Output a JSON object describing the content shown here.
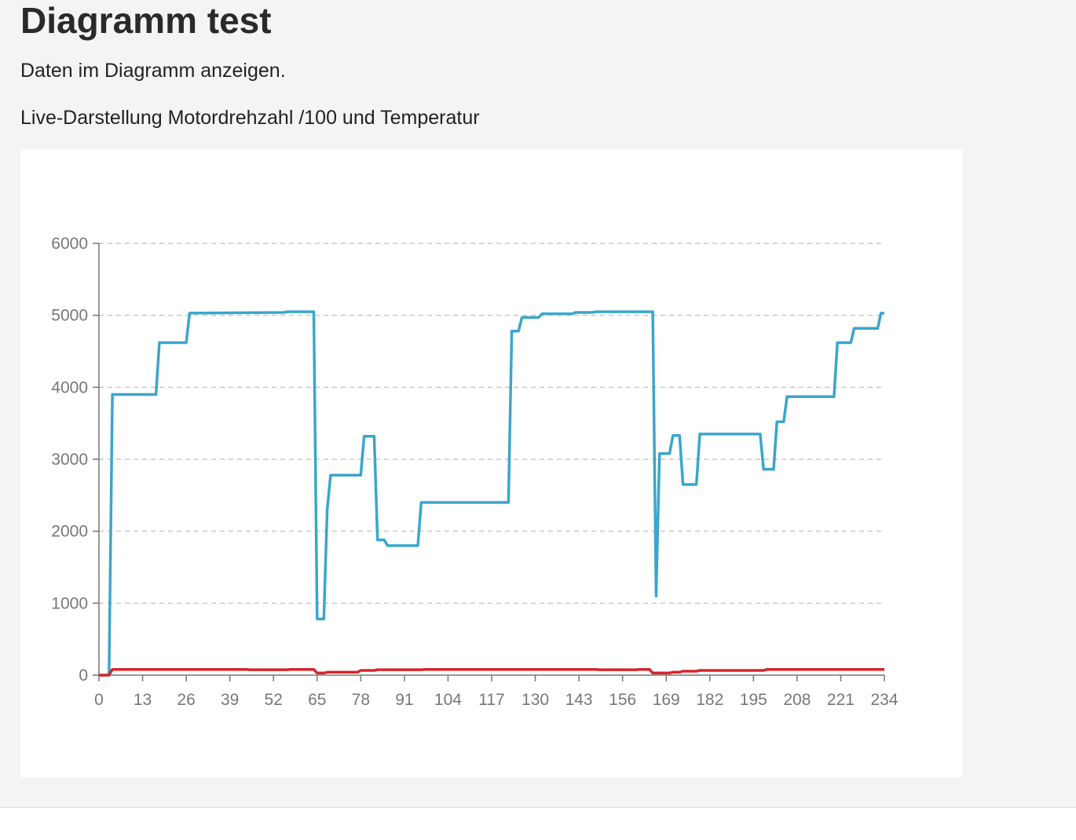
{
  "page": {
    "title": "Diagramm test",
    "description": "Daten im Diagramm anzeigen.",
    "chart_heading": "Live-Darstellung Motordrehzahl /100 und Temperatur"
  },
  "colors": {
    "background": "#f4f4f4",
    "card": "#ffffff",
    "series_rpm": "#3aa6cc",
    "series_temp": "#d6262c",
    "grid": "#c8c8c8",
    "axis": "#777777"
  },
  "chart_data": {
    "type": "line",
    "title": "",
    "xlabel": "",
    "ylabel": "",
    "xlim": [
      0,
      234
    ],
    "ylim": [
      0,
      6000
    ],
    "x_ticks": [
      0,
      13,
      26,
      39,
      52,
      65,
      78,
      91,
      104,
      117,
      130,
      143,
      156,
      169,
      182,
      195,
      208,
      221,
      234
    ],
    "y_ticks": [
      0,
      1000,
      2000,
      3000,
      4000,
      5000,
      6000
    ],
    "grid": "horizontal dashed",
    "legend": "none",
    "series": [
      {
        "color": "#3aa6cc",
        "points": [
          [
            0,
            0
          ],
          [
            3,
            0
          ],
          [
            4,
            3900
          ],
          [
            17,
            3900
          ],
          [
            18,
            4620
          ],
          [
            26,
            4620
          ],
          [
            27,
            5030
          ],
          [
            55,
            5040
          ],
          [
            56,
            5050
          ],
          [
            64,
            5050
          ],
          [
            65,
            780
          ],
          [
            67,
            780
          ],
          [
            68,
            2300
          ],
          [
            69,
            2780
          ],
          [
            78,
            2780
          ],
          [
            79,
            3320
          ],
          [
            82,
            3320
          ],
          [
            83,
            1880
          ],
          [
            85,
            1880
          ],
          [
            86,
            1800
          ],
          [
            95,
            1800
          ],
          [
            96,
            2400
          ],
          [
            122,
            2400
          ],
          [
            123,
            4780
          ],
          [
            125,
            4780
          ],
          [
            126,
            4970
          ],
          [
            131,
            4970
          ],
          [
            132,
            5020
          ],
          [
            141,
            5020
          ],
          [
            142,
            5040
          ],
          [
            147,
            5040
          ],
          [
            148,
            5050
          ],
          [
            165,
            5050
          ],
          [
            166,
            1100
          ],
          [
            167,
            3080
          ],
          [
            170,
            3080
          ],
          [
            171,
            3330
          ],
          [
            173,
            3330
          ],
          [
            174,
            2650
          ],
          [
            178,
            2650
          ],
          [
            179,
            3350
          ],
          [
            197,
            3350
          ],
          [
            198,
            2860
          ],
          [
            201,
            2860
          ],
          [
            202,
            3520
          ],
          [
            204,
            3520
          ],
          [
            205,
            3870
          ],
          [
            219,
            3870
          ],
          [
            220,
            4620
          ],
          [
            224,
            4620
          ],
          [
            225,
            4820
          ],
          [
            232,
            4820
          ],
          [
            233,
            5030
          ],
          [
            234,
            5030
          ]
        ]
      },
      {
        "color": "#d6262c",
        "points": [
          [
            0,
            0
          ],
          [
            3,
            0
          ],
          [
            4,
            80
          ],
          [
            44,
            80
          ],
          [
            45,
            75
          ],
          [
            56,
            75
          ],
          [
            57,
            80
          ],
          [
            64,
            80
          ],
          [
            65,
            30
          ],
          [
            67,
            30
          ],
          [
            68,
            40
          ],
          [
            77,
            40
          ],
          [
            78,
            65
          ],
          [
            82,
            65
          ],
          [
            83,
            75
          ],
          [
            96,
            75
          ],
          [
            97,
            80
          ],
          [
            148,
            80
          ],
          [
            149,
            75
          ],
          [
            160,
            75
          ],
          [
            161,
            80
          ],
          [
            164,
            80
          ],
          [
            165,
            30
          ],
          [
            170,
            30
          ],
          [
            171,
            40
          ],
          [
            173,
            40
          ],
          [
            174,
            55
          ],
          [
            178,
            55
          ],
          [
            179,
            65
          ],
          [
            198,
            65
          ],
          [
            199,
            80
          ],
          [
            234,
            80
          ]
        ]
      }
    ]
  }
}
